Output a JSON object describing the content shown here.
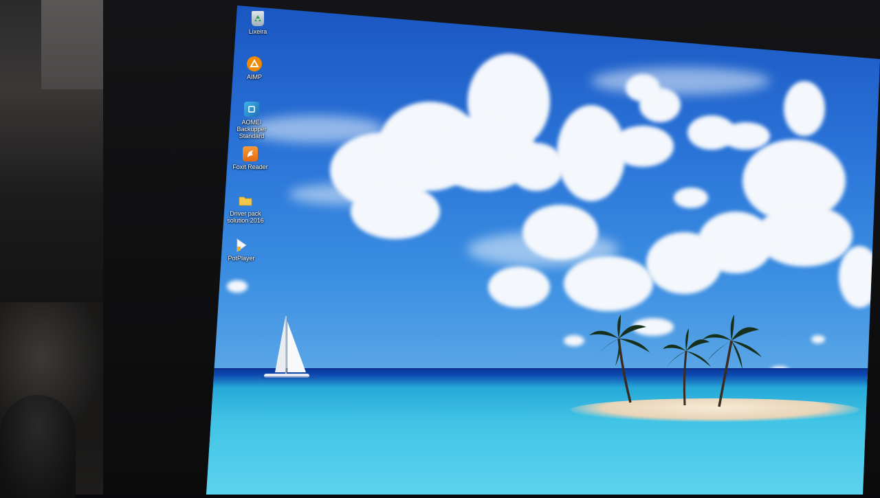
{
  "desktop": {
    "icons": [
      {
        "name": "recycle-bin-icon",
        "label": "Lixeira"
      },
      {
        "name": "aimp-icon",
        "label": "AIMP"
      },
      {
        "name": "aomei-backupper-icon",
        "label": "AOMEI Backupper\nStandard"
      },
      {
        "name": "foxit-reader-icon",
        "label": "Foxit Reader"
      },
      {
        "name": "folder-icon",
        "label": "Driver pack\nsolution 2016"
      },
      {
        "name": "potplayer-icon",
        "label": "PotPlayer"
      }
    ]
  },
  "colors": {
    "sky": "#2a74d8",
    "sea": "#41c4e6",
    "aimp": "#f08a00",
    "aomei": "#1f8fd6",
    "foxit": "#f07a1a",
    "folder": "#f3c64c"
  }
}
